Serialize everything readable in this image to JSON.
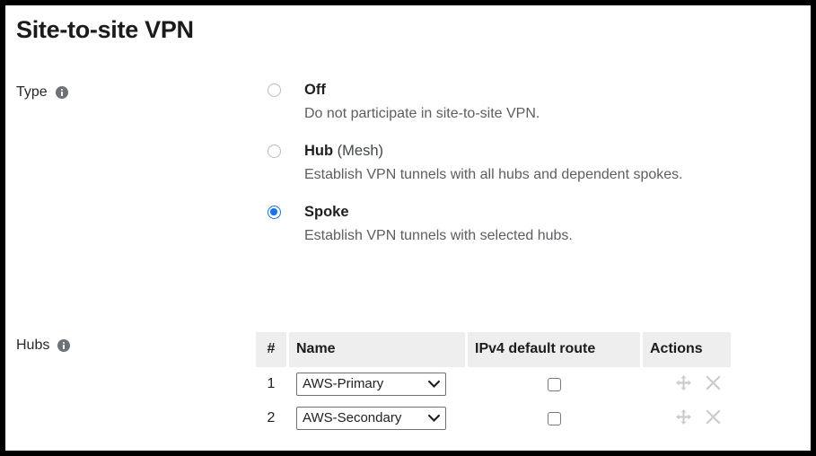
{
  "page": {
    "title": "Site-to-site VPN"
  },
  "type_field": {
    "label": "Type",
    "info_icon": "info-icon",
    "options": [
      {
        "value": "off",
        "title": "Off",
        "suffix": "",
        "description": "Do not participate in site-to-site VPN.",
        "selected": false
      },
      {
        "value": "hub",
        "title": "Hub",
        "suffix": " (Mesh)",
        "description": "Establish VPN tunnels with all hubs and dependent spokes.",
        "selected": false
      },
      {
        "value": "spoke",
        "title": "Spoke",
        "suffix": "",
        "description": "Establish VPN tunnels with selected hubs.",
        "selected": true
      }
    ],
    "selected_value": "spoke"
  },
  "hubs_field": {
    "label": "Hubs",
    "info_icon": "info-icon",
    "table": {
      "headers": {
        "index": "#",
        "name": "Name",
        "route": "IPv4 default route",
        "actions": "Actions"
      },
      "rows": [
        {
          "index": "1",
          "name": "AWS-Primary",
          "name_options": [
            "AWS-Primary",
            "AWS-Secondary"
          ],
          "ipv4_default_route_checked": false,
          "actions": {
            "move_icon": "move-icon",
            "delete_icon": "close-icon"
          }
        },
        {
          "index": "2",
          "name": "AWS-Secondary",
          "name_options": [
            "AWS-Primary",
            "AWS-Secondary"
          ],
          "ipv4_default_route_checked": false,
          "actions": {
            "move_icon": "move-icon",
            "delete_icon": "close-icon"
          }
        }
      ]
    }
  },
  "colors": {
    "accent": "#1a73e8",
    "header_background": "#eeeeee",
    "text_primary": "#1d1f21",
    "text_secondary": "#5b5e62",
    "icon_muted": "#c9cbcc",
    "frame": "#000000"
  }
}
